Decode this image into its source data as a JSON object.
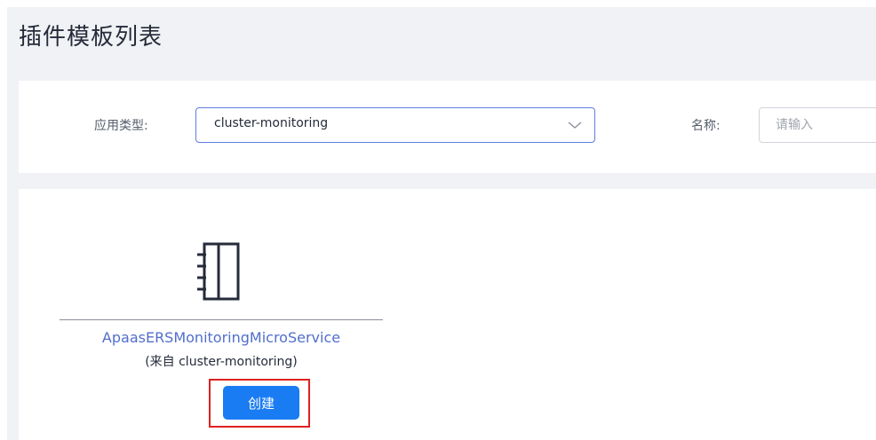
{
  "page": {
    "title": "插件模板列表"
  },
  "filters": {
    "app_type_label": "应用类型:",
    "app_type_value": "cluster-monitoring",
    "name_label": "名称:",
    "name_placeholder": "请输入",
    "name_value": ""
  },
  "plugins": [
    {
      "name": "ApaasERSMonitoringMicroService",
      "source": "(来自 cluster-monitoring)",
      "create_label": "创建",
      "icon": "notebook-icon"
    }
  ],
  "colors": {
    "primary": "#1a7cf2",
    "link": "#526ecc",
    "highlight": "#e02020",
    "page_bg": "#f1f2f5"
  }
}
